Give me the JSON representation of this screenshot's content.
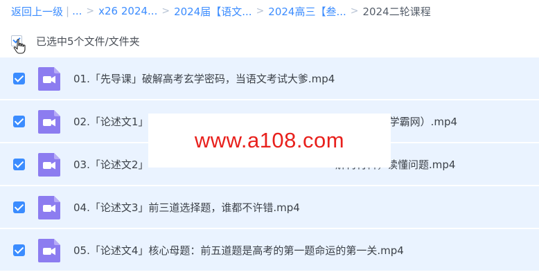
{
  "breadcrumb": {
    "back": "返回上一级",
    "divider": "|",
    "ellipsis": "...",
    "items": [
      "x26 2024...",
      "2024届【语文...",
      "2024高三【叁...",
      "2024二轮课程"
    ],
    "separator": ">"
  },
  "selection": {
    "text": "已选中5个文件/文件夹"
  },
  "files": [
    {
      "name": "01.「先导课」破解高考玄学密码，当语文考试大爹.mp4",
      "checked": true
    },
    {
      "name": "02.「论述文1」",
      "name_tail": "org学霸网）.mp4",
      "checked": true
    },
    {
      "name": "03.「论述文2」",
      "name_tail": "解构材料，读懂问题.mp4",
      "checked": true
    },
    {
      "name": "04.「论述文3」前三道选择题，谁都不许错.mp4",
      "checked": true
    },
    {
      "name": "05.「论述文4」核心母题：前五道题是高考的第一题命运的第一关.mp4",
      "checked": true
    }
  ],
  "watermark": {
    "text": "www.a108.com"
  },
  "colors": {
    "accent": "#3b8cff",
    "row_bg": "#eaf3ff",
    "video_icon": "#8c7cf0",
    "watermark": "#e8201c"
  },
  "icons": {
    "file": "video-file-icon",
    "cursor": "hand-pointer-icon"
  }
}
